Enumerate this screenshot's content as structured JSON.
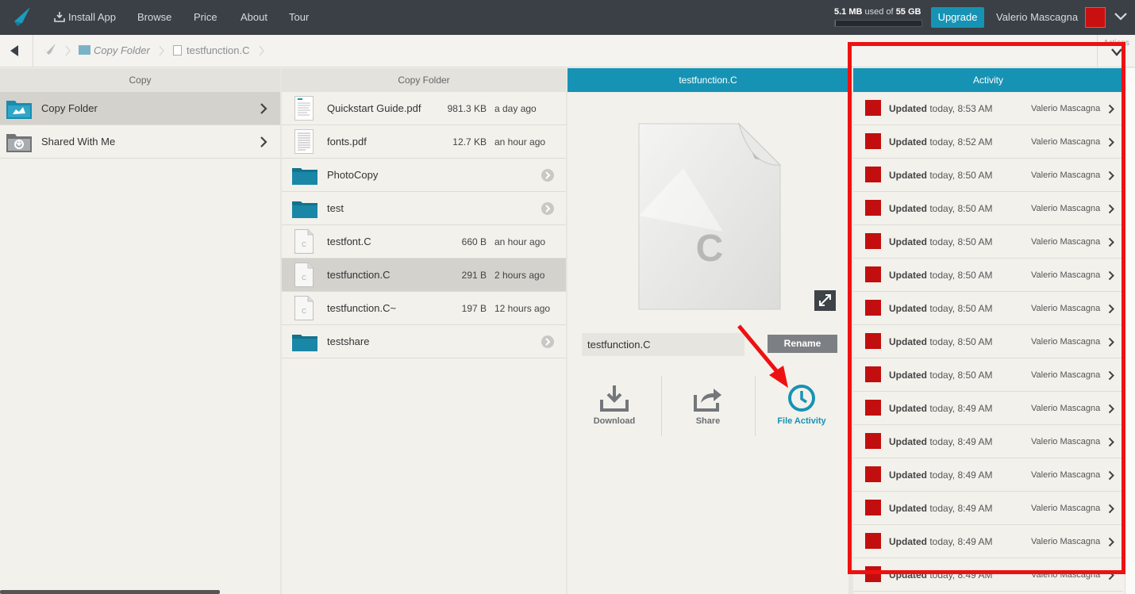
{
  "topbar": {
    "install_app": "Install App",
    "browse": "Browse",
    "price": "Price",
    "about": "About",
    "tour": "Tour",
    "storage_used": "5.1 MB",
    "storage_mid": "used of",
    "storage_total": "55 GB",
    "storage_fraction": 0.0001,
    "upgrade": "Upgrade",
    "username": "Valerio Mascagna"
  },
  "breadcrumb": {
    "folder": "Copy Folder",
    "file": "testfunction.C",
    "actions": "Actions"
  },
  "columns": {
    "copy": "Copy",
    "copy_folder": "Copy Folder",
    "file": "testfunction.C",
    "activity": "Activity"
  },
  "copy_items": [
    {
      "label": "Copy Folder"
    },
    {
      "label": "Shared With Me"
    }
  ],
  "folder_items": [
    {
      "name": "Quickstart Guide.pdf",
      "size": "981.3 KB",
      "time": "a day ago"
    },
    {
      "name": "fonts.pdf",
      "size": "12.7 KB",
      "time": "an hour ago"
    },
    {
      "name": "PhotoCopy",
      "size": "",
      "time": ""
    },
    {
      "name": "test",
      "size": "",
      "time": ""
    },
    {
      "name": "testfont.C",
      "size": "660 B",
      "time": "an hour ago"
    },
    {
      "name": "testfunction.C",
      "size": "291 B",
      "time": "2 hours ago"
    },
    {
      "name": "testfunction.C~",
      "size": "197 B",
      "time": "12 hours ago"
    },
    {
      "name": "testshare",
      "size": "",
      "time": ""
    }
  ],
  "file_panel": {
    "extension_letter": "C",
    "name_value": "testfunction.C",
    "rename": "Rename",
    "download": "Download",
    "share": "Share",
    "file_activity": "File Activity"
  },
  "activity": [
    {
      "verb": "Updated",
      "when": "today, 8:53 AM",
      "who": "Valerio Mascagna"
    },
    {
      "verb": "Updated",
      "when": "today, 8:52 AM",
      "who": "Valerio Mascagna"
    },
    {
      "verb": "Updated",
      "when": "today, 8:50 AM",
      "who": "Valerio Mascagna"
    },
    {
      "verb": "Updated",
      "when": "today, 8:50 AM",
      "who": "Valerio Mascagna"
    },
    {
      "verb": "Updated",
      "when": "today, 8:50 AM",
      "who": "Valerio Mascagna"
    },
    {
      "verb": "Updated",
      "when": "today, 8:50 AM",
      "who": "Valerio Mascagna"
    },
    {
      "verb": "Updated",
      "when": "today, 8:50 AM",
      "who": "Valerio Mascagna"
    },
    {
      "verb": "Updated",
      "when": "today, 8:50 AM",
      "who": "Valerio Mascagna"
    },
    {
      "verb": "Updated",
      "when": "today, 8:50 AM",
      "who": "Valerio Mascagna"
    },
    {
      "verb": "Updated",
      "when": "today, 8:49 AM",
      "who": "Valerio Mascagna"
    },
    {
      "verb": "Updated",
      "when": "today, 8:49 AM",
      "who": "Valerio Mascagna"
    },
    {
      "verb": "Updated",
      "when": "today, 8:49 AM",
      "who": "Valerio Mascagna"
    },
    {
      "verb": "Updated",
      "when": "today, 8:49 AM",
      "who": "Valerio Mascagna"
    },
    {
      "verb": "Updated",
      "when": "today, 8:49 AM",
      "who": "Valerio Mascagna"
    },
    {
      "verb": "Updated",
      "when": "today, 8:49 AM",
      "who": "Valerio Mascagna"
    }
  ],
  "colors": {
    "accent": "#1693b4",
    "topbar": "#3b4046",
    "highlight": "#ee1111"
  }
}
